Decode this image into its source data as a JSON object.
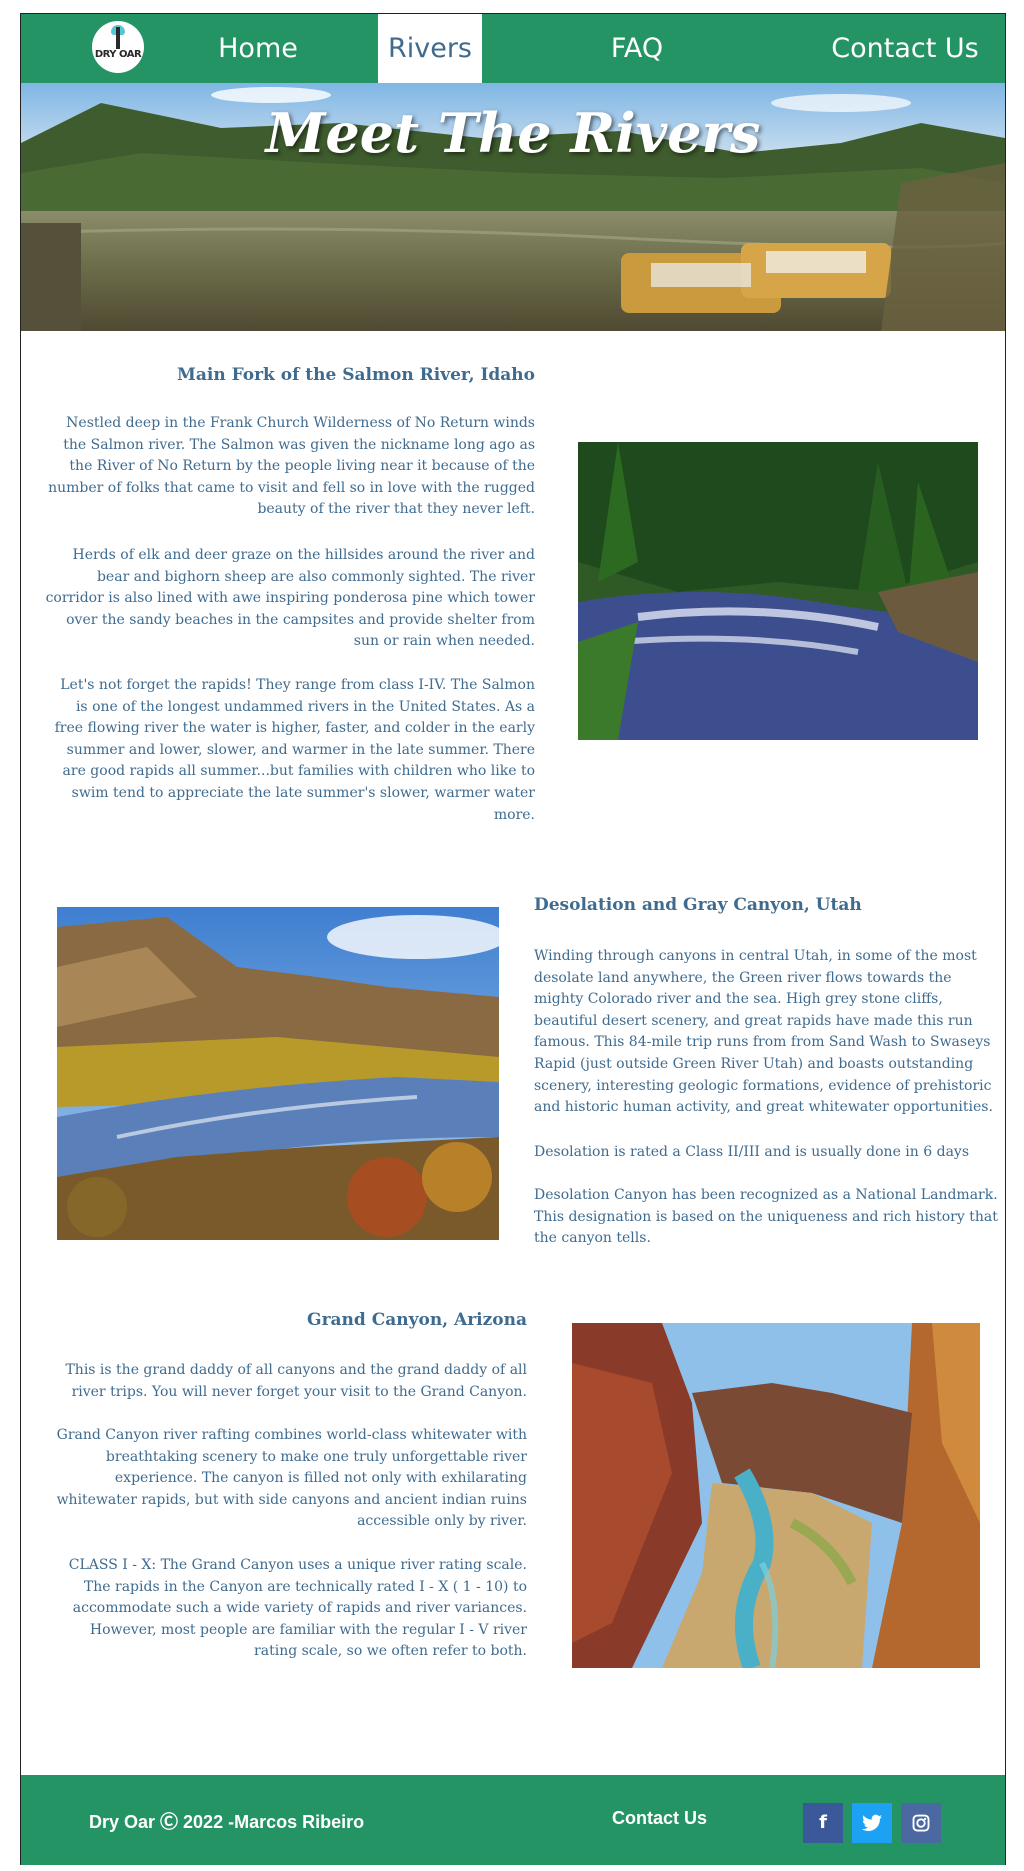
{
  "nav": {
    "logo_text": "DRY OAR",
    "items": [
      {
        "label": "Home"
      },
      {
        "label": "Rivers"
      },
      {
        "label": "FAQ"
      },
      {
        "label": "Contact Us"
      }
    ],
    "active": "Rivers",
    "bg_color": "#249465"
  },
  "hero": {
    "title": "Meet The Rivers"
  },
  "sections": [
    {
      "title": "Main Fork of the Salmon River, Idaho",
      "paragraphs": [
        "Nestled deep in the Frank Church Wilderness of No Return winds the Salmon river. The Salmon was given the nickname long ago as the River of No Return by the people living near it because of the number of folks that came to visit and fell so in love with the rugged beauty of the river that they never left.",
        "Herds of elk and deer graze on the hillsides around the river and bear and bighorn sheep are also commonly sighted. The river corridor is also lined with awe inspiring ponderosa pine which tower over the sandy beaches in the campsites and provide shelter from sun or rain when needed.",
        "Let's not forget the rapids! They range from class I-IV. The Salmon is one of the longest undammed rivers in the United States. As a free flowing river the water is higher, faster, and colder in the early summer and lower, slower, and warmer in the late summer. There are good rapids all summer...but families with children who like to swim tend to appreciate the late summer's slower, warmer water more."
      ]
    },
    {
      "title": "Desolation and Gray Canyon, Utah",
      "paragraphs": [
        "Winding through canyons in central Utah, in some of the most desolate land anywhere, the Green river flows towards the mighty Colorado river and the sea. High grey stone cliffs, beautiful desert scenery, and great rapids have made this run famous. This 84-mile trip runs from from Sand Wash to Swaseys Rapid (just outside Green River Utah) and boasts outstanding scenery, interesting geologic formations, evidence of prehistoric and historic human activity, and great whitewater opportunities.",
        "Desolation is rated a Class II/III and is usually done in 6 days",
        "Desolation Canyon has been recognized as a National Landmark.  This designation is based on the uniqueness and rich history that the canyon tells."
      ]
    },
    {
      "title": "Grand Canyon, Arizona",
      "paragraphs": [
        "This is the grand daddy of all canyons and the grand daddy of all river trips. You will never forget your visit to the Grand Canyon.",
        "Grand Canyon river rafting combines world-class whitewater with breathtaking scenery to make one truly unforgettable river experience. The canyon is filled not only with exhilarating whitewater rapids, but with side canyons and ancient indian ruins accessible only by river.",
        "CLASS I - X: The Grand Canyon uses a unique river rating scale. The rapids in the Canyon are technically rated I - X ( 1 - 10) to accommodate such a wide variety of rapids and river variances. However, most people are familiar with the regular I - V river rating scale, so we often refer to both."
      ]
    }
  ],
  "footer": {
    "copyright": "Dry Oar Ⓒ 2022 -Marcos Ribeiro",
    "contact_label": "Contact Us",
    "social": [
      {
        "icon": "facebook-icon",
        "glyph": "f",
        "color": "#3b5998"
      },
      {
        "icon": "twitter-icon",
        "glyph": "t",
        "color": "#1da1f2"
      },
      {
        "icon": "instagram-icon",
        "glyph": "◎",
        "color": "#4c68a0"
      }
    ]
  }
}
